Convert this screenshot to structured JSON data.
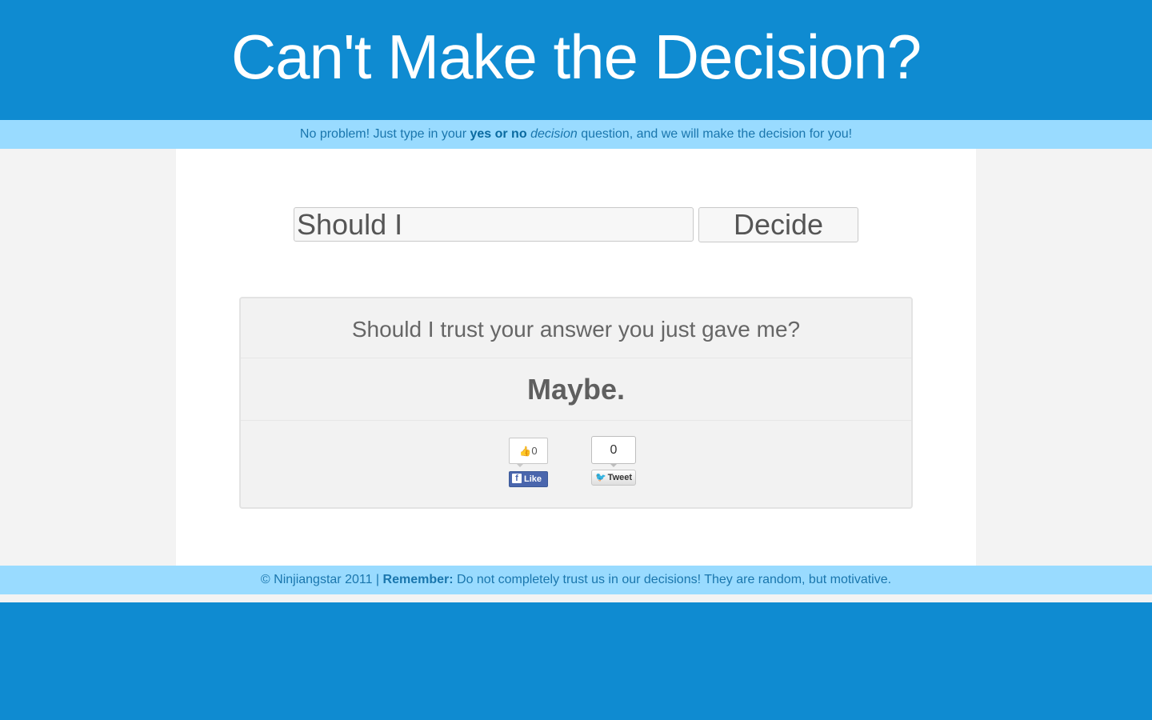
{
  "header": {
    "title": "Can't Make the Decision?"
  },
  "subbar": {
    "text_before": "No problem! Just type in your ",
    "bold_text": "yes or no",
    "italic_text": "decision",
    "text_after": " question, and we will make the decision for you!"
  },
  "form": {
    "question_value": "Should I",
    "decide_label": "Decide"
  },
  "answer": {
    "question": "Should I trust your answer you just gave me?",
    "result": "Maybe."
  },
  "social": {
    "facebook_count": "0",
    "facebook_label": "Like",
    "facebook_icon": "facebook-f-icon",
    "thumbs_icon": "thumbs-up-icon",
    "tweet_count": "0",
    "tweet_label": "Tweet",
    "twitter_icon": "twitter-bird-icon"
  },
  "footer": {
    "copyright": "© Ninjiangstar 2011 | ",
    "remember_label": "Remember:",
    "message": " Do not completely trust us in our decisions! They are random, but motivative."
  },
  "colors": {
    "primary_blue": "#0f8bd1",
    "light_blue_bar": "#99dbff",
    "page_background": "#f3f3f3",
    "facebook_blue": "#4a66ad",
    "twitter_blue": "#2ba9e1"
  }
}
